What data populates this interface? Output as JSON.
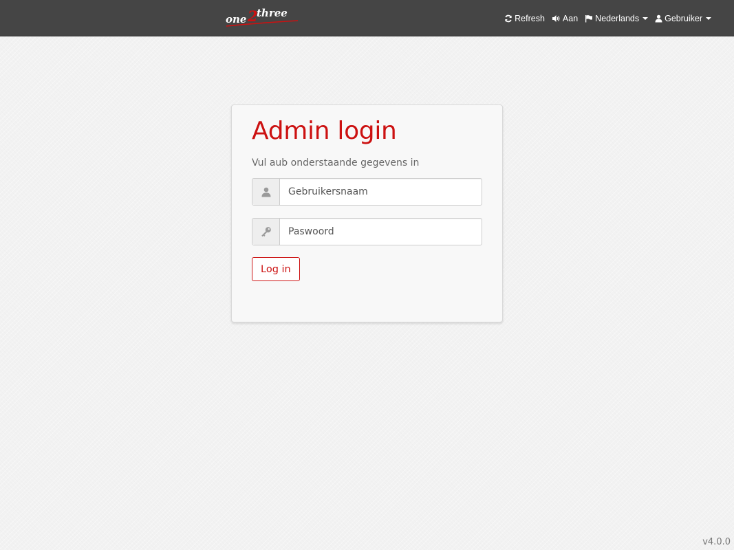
{
  "navbar": {
    "brand": {
      "logo_text_a": "one",
      "logo_text_b": "2",
      "logo_text_c": "three"
    },
    "items": [
      {
        "label": "Refresh",
        "icon": "refresh-icon",
        "dropdown": false
      },
      {
        "label": "Aan",
        "icon": "volume-icon",
        "dropdown": false
      },
      {
        "label": "Nederlands",
        "icon": "flag-icon",
        "dropdown": true
      },
      {
        "label": "Gebruiker",
        "icon": "user-icon",
        "dropdown": true
      }
    ]
  },
  "login": {
    "title": "Admin login",
    "subtitle": "Vul aub onderstaande gegevens in",
    "username_placeholder": "Gebruikersnaam",
    "password_placeholder": "Paswoord",
    "submit_label": "Log in"
  },
  "footer": {
    "version": "v4.0.0"
  },
  "colors": {
    "accent": "#cc1111",
    "navbar_bg": "#454545",
    "page_bg": "#f2f2f2"
  }
}
